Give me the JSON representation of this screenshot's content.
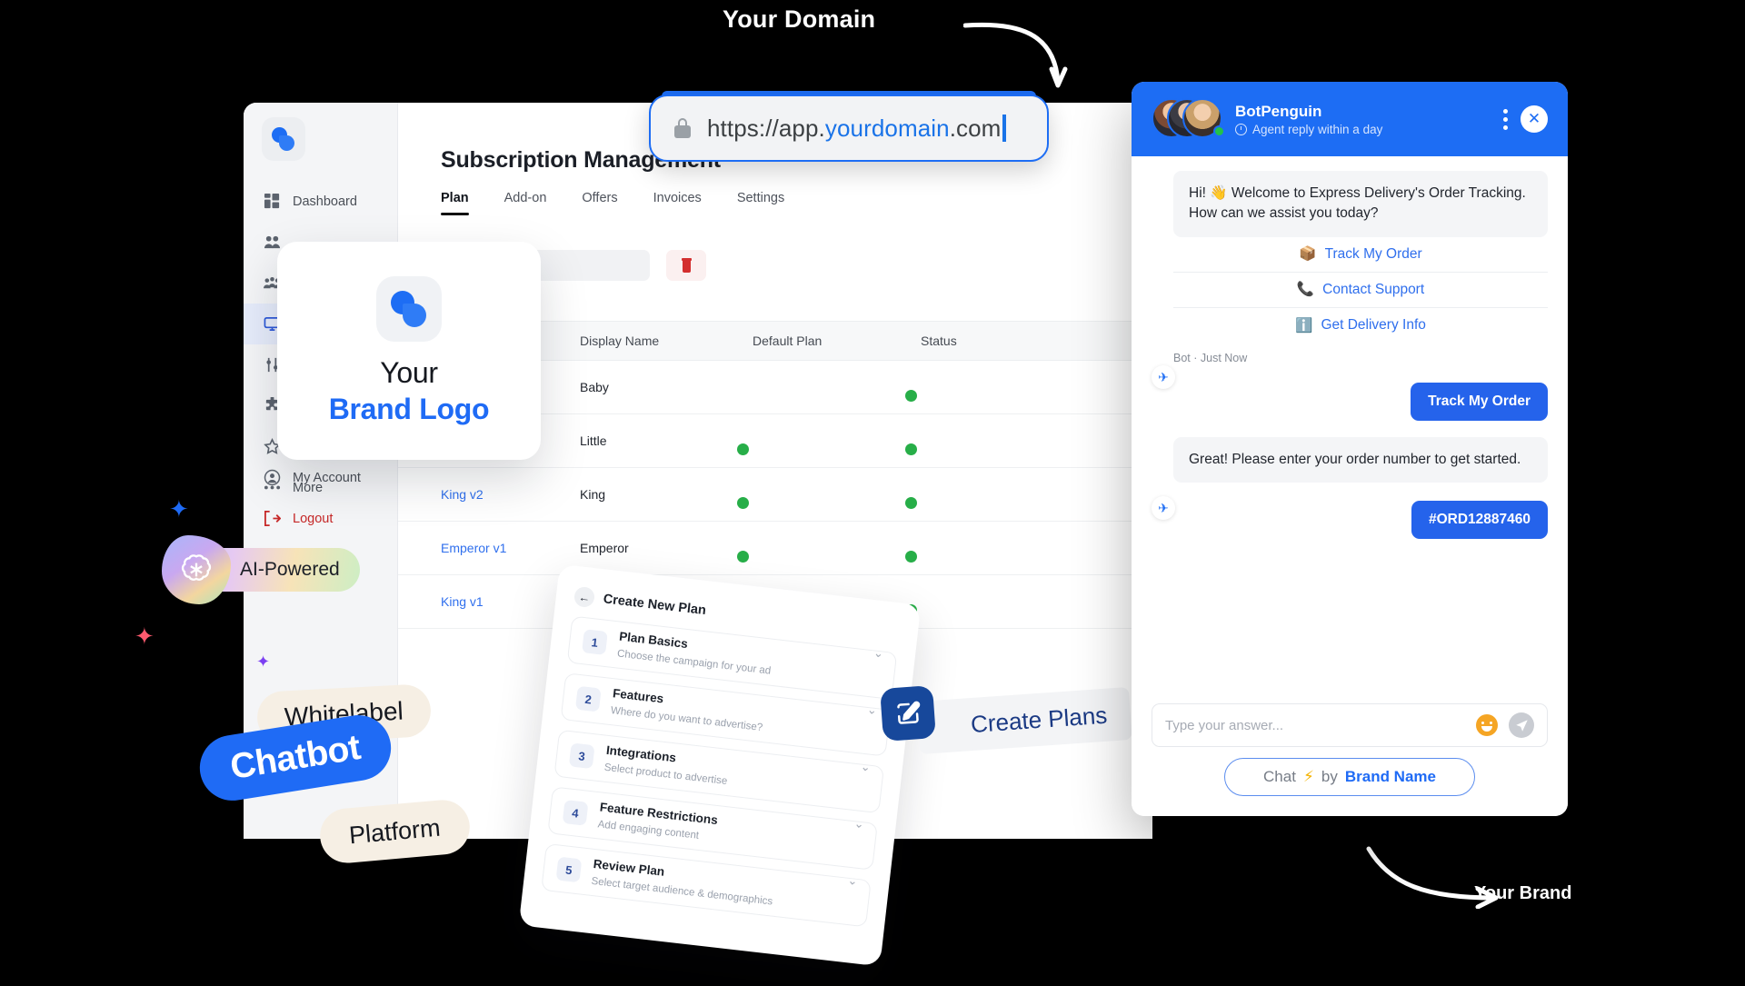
{
  "annotations": {
    "top_label": "Your Domain",
    "bottom_label": "Your Brand"
  },
  "browser": {
    "lock_icon": "lock-icon",
    "url_prefix": "https://app.",
    "url_highlight": "yourdomain",
    "url_suffix": ".com"
  },
  "dashboard": {
    "logo_icon": "botpenguin-logo-icon",
    "page_title": "Subscription Management",
    "tabs": [
      {
        "label": "Plan",
        "active": true
      },
      {
        "label": "Add-on",
        "active": false
      },
      {
        "label": "Offers",
        "active": false
      },
      {
        "label": "Invoices",
        "active": false
      },
      {
        "label": "Settings",
        "active": false
      }
    ],
    "sidebar": {
      "items": [
        {
          "label": "Dashboard",
          "icon": "grid-icon",
          "active": false
        },
        {
          "label": "",
          "icon": "users-icon",
          "active": false
        },
        {
          "label": "",
          "icon": "team-icon",
          "active": false
        },
        {
          "label": "",
          "icon": "monitor-icon",
          "active": true
        },
        {
          "label": "",
          "icon": "sliders-icon",
          "active": false
        },
        {
          "label": "",
          "icon": "puzzle-icon",
          "active": false
        },
        {
          "label": "",
          "icon": "star-icon",
          "active": false
        },
        {
          "label": "More",
          "icon": "ellipsis-icon",
          "active": false
        }
      ],
      "bottom_items": [
        {
          "label": "My Account",
          "icon": "user-circle-icon"
        },
        {
          "label": "Logout",
          "icon": "logout-icon"
        }
      ]
    },
    "toolbar": {
      "search_placeholder": "",
      "delete_icon": "trash-icon"
    },
    "table": {
      "columns": [
        "",
        "Display Name",
        "Default Plan",
        "Status"
      ],
      "rows": [
        {
          "plan": "",
          "display_name": "Baby",
          "default_plan": false,
          "status": true
        },
        {
          "plan": "",
          "display_name": "Little",
          "default_plan": true,
          "status": true
        },
        {
          "plan": "King v2",
          "display_name": "King",
          "default_plan": true,
          "status": true
        },
        {
          "plan": "Emperor v1",
          "display_name": "Emperor",
          "default_plan": true,
          "status": true
        },
        {
          "plan": "King v1",
          "display_name": "",
          "default_plan": false,
          "status": true
        }
      ]
    }
  },
  "logo_card": {
    "icon": "botpenguin-logo-icon",
    "line1": "Your",
    "line2": "Brand Logo"
  },
  "chips": {
    "ai_powered": "AI-Powered",
    "ai_icon": "openai-icon",
    "whitelabel": "Whitelabel",
    "chatbot": "Chatbot",
    "platform": "Platform",
    "create_plans": "Create Plans",
    "create_plans_icon": "edit-square-icon"
  },
  "wizard": {
    "back_icon": "arrow-left-icon",
    "title": "Create New Plan",
    "steps": [
      {
        "num": "1",
        "title": "Plan Basics",
        "subtitle": "Choose the campaign for your ad"
      },
      {
        "num": "2",
        "title": "Features",
        "subtitle": "Where do you want to advertise?"
      },
      {
        "num": "3",
        "title": "Integrations",
        "subtitle": "Select product to advertise"
      },
      {
        "num": "4",
        "title": "Feature Restrictions",
        "subtitle": "Add engaging content"
      },
      {
        "num": "5",
        "title": "Review Plan",
        "subtitle": "Select target audience & demographics"
      }
    ]
  },
  "chat": {
    "header": {
      "name": "BotPenguin",
      "status": "Agent reply within a day",
      "clock_icon": "clock-icon",
      "menu_icon": "kebab-menu-icon",
      "close_icon": "close-icon"
    },
    "messages": [
      {
        "type": "bot",
        "text": "Hi! 👋 Welcome to Express Delivery's Order Tracking. How can we assist you today?",
        "options": [
          {
            "emoji": "📦",
            "label": "Track My Order"
          },
          {
            "emoji": "📞",
            "label": "Contact Support"
          },
          {
            "emoji": "ℹ️",
            "label": "Get Delivery Info"
          }
        ],
        "meta": "Bot · Just Now"
      },
      {
        "type": "user",
        "text": "Track My Order"
      },
      {
        "type": "bot",
        "text": "Great! Please enter your order number to get started."
      },
      {
        "type": "user",
        "text": "#ORD12887460"
      }
    ],
    "footer": {
      "placeholder": "Type your answer...",
      "emoji_icon": "emoji-icon",
      "send_icon": "send-icon",
      "brand_prefix": "Chat",
      "brand_bolt": "⚡",
      "brand_by": "by",
      "brand_name": "Brand Name"
    }
  },
  "colors": {
    "accent": "#1d6df4",
    "accent_dark": "#2563eb",
    "green": "#27ae48",
    "danger": "#c62828",
    "chip_cream": "#f6efe4"
  }
}
